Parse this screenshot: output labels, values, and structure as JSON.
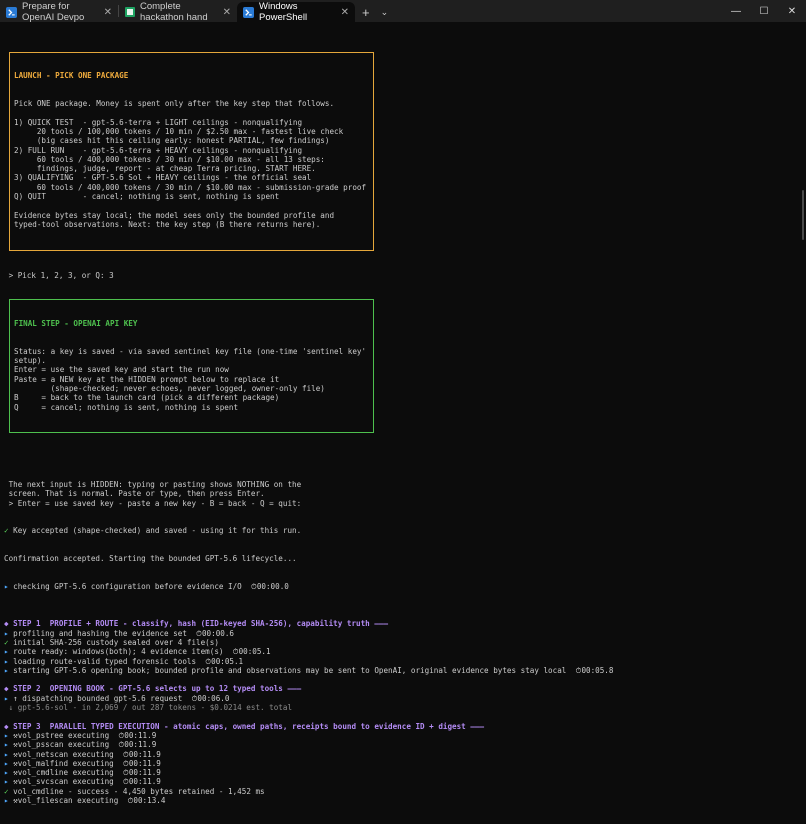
{
  "tabs": [
    {
      "label": "Prepare for OpenAI Devpo",
      "icon": "powershell-icon"
    },
    {
      "label": "Complete hackathon hand",
      "icon": "spreadsheet-icon"
    },
    {
      "label": "Windows PowerShell",
      "icon": "powershell-icon",
      "active": true
    }
  ],
  "tab_close": "✕",
  "new_tab": "+",
  "dropdown": "⌄",
  "window_controls": {
    "minimize": "—",
    "maximize": "☐",
    "close": "✕"
  },
  "launch_box": {
    "title": "LAUNCH - PICK ONE PACKAGE",
    "lines": [
      "Pick ONE package. Money is spent only after the key step that follows.",
      "",
      "1) QUICK TEST  - gpt-5.6-terra + LIGHT ceilings - nonqualifying",
      "     20 tools / 100,000 tokens / 10 min / $2.50 max - fastest live check",
      "     (big cases hit this ceiling early: honest PARTIAL, few findings)",
      "2) FULL RUN    - gpt-5.6-terra + HEAVY ceilings - nonqualifying",
      "     60 tools / 400,000 tokens / 30 min / $10.00 max - all 13 steps:",
      "     findings, judge, report - at cheap Terra pricing. START HERE.",
      "3) QUALIFYING  - GPT-5.6 Sol + HEAVY ceilings - the official seal",
      "     60 tools / 400,000 tokens / 30 min / $10.00 max - submission-grade proof",
      "Q) QUIT        - cancel; nothing is sent, nothing is spent",
      "",
      "Evidence bytes stay local; the model sees only the bounded profile and",
      "typed-tool observations. Next: the key step (B there returns here)."
    ]
  },
  "pick_prompt": " > Pick 1, 2, 3, or Q: 3",
  "key_box": {
    "title": "FINAL STEP - OPENAI API KEY",
    "lines": [
      "Status: a key is saved - via saved sentinel key file (one-time 'sentinel key'",
      "setup).",
      "Enter = use the saved key and start the run now",
      "Paste = a NEW key at the HIDDEN prompt below to replace it",
      "        (shape-checked; never echoes, never logged, owner-only file)",
      "B     = back to the launch card (pick a different package)",
      "Q     = cancel; nothing is sent, nothing is spent"
    ]
  },
  "hidden_notice": [
    " The next input is HIDDEN: typing or pasting shows NOTHING on the",
    " screen. That is normal. Paste or type, then press Enter.",
    " > Enter = use saved key - paste a new key - B = back - Q = quit:"
  ],
  "key_accepted": "Key accepted (shape-checked) and saved - using it for this run.",
  "confirmation": "Confirmation accepted. Starting the bounded GPT-5.6 lifecycle...",
  "checking": {
    "text": "checking GPT-5.6 configuration before evidence I/O",
    "time": "00:00.0"
  },
  "steps": [
    {
      "header": "◆ STEP 1  PROFILE + ROUTE - classify, hash (EID-keyed SHA-256), capability truth ———",
      "lines": [
        {
          "mark": "▸",
          "kind": "arrow",
          "text": "profiling and hashing the evidence set",
          "time": "00:00.6"
        },
        {
          "mark": "✓",
          "kind": "check",
          "text": "initial SHA-256 custody sealed over 4 file(s)",
          "time": ""
        },
        {
          "mark": "▸",
          "kind": "arrow",
          "text": "route ready: windows(both); 4 evidence item(s)",
          "time": "00:05.1"
        },
        {
          "mark": "▸",
          "kind": "arrow",
          "text": "loading route-valid typed forensic tools",
          "time": "00:05.1"
        },
        {
          "mark": "▸",
          "kind": "arrow",
          "text": "starting GPT-5.6 opening book; bounded profile and observations may be sent to OpenAI, original evidence bytes stay local",
          "time": "00:05.8"
        }
      ]
    },
    {
      "header": "◆ STEP 2  OPENING BOOK - GPT-5.6 selects up to 12 typed tools ———",
      "lines": [
        {
          "mark": "▸",
          "kind": "arrow",
          "text": "↑ dispatching bounded gpt-5.6 request",
          "time": "00:06.0"
        },
        {
          "mark": "",
          "kind": "dim",
          "text": " ↓ gpt-5.6-sol - in 2,069 / out 287 tokens - $0.0214 est. total",
          "time": ""
        }
      ]
    },
    {
      "header": "◆ STEP 3  PARALLEL TYPED EXECUTION - atomic caps, owned paths, receipts bound to evidence ID + digest ———",
      "lines": [
        {
          "mark": "▸",
          "kind": "arrow",
          "text": "⚒vol_pstree executing",
          "time": "00:11.9"
        },
        {
          "mark": "▸",
          "kind": "arrow",
          "text": "⚒vol_psscan executing",
          "time": "00:11.9"
        },
        {
          "mark": "▸",
          "kind": "arrow",
          "text": "⚒vol_netscan executing",
          "time": "00:11.9"
        },
        {
          "mark": "▸",
          "kind": "arrow",
          "text": "⚒vol_malfind executing",
          "time": "00:11.9"
        },
        {
          "mark": "▸",
          "kind": "arrow",
          "text": "⚒vol_cmdline executing",
          "time": "00:11.9"
        },
        {
          "mark": "▸",
          "kind": "arrow",
          "text": "⚒vol_svcscan executing",
          "time": "00:11.9"
        },
        {
          "mark": "✓",
          "kind": "check",
          "text": "vol_cmdline - success - 4,450 bytes retained - 1,452 ms",
          "time": ""
        },
        {
          "mark": "▸",
          "kind": "arrow",
          "text": "⚒vol_filescan executing",
          "time": "00:13.4"
        }
      ]
    }
  ]
}
